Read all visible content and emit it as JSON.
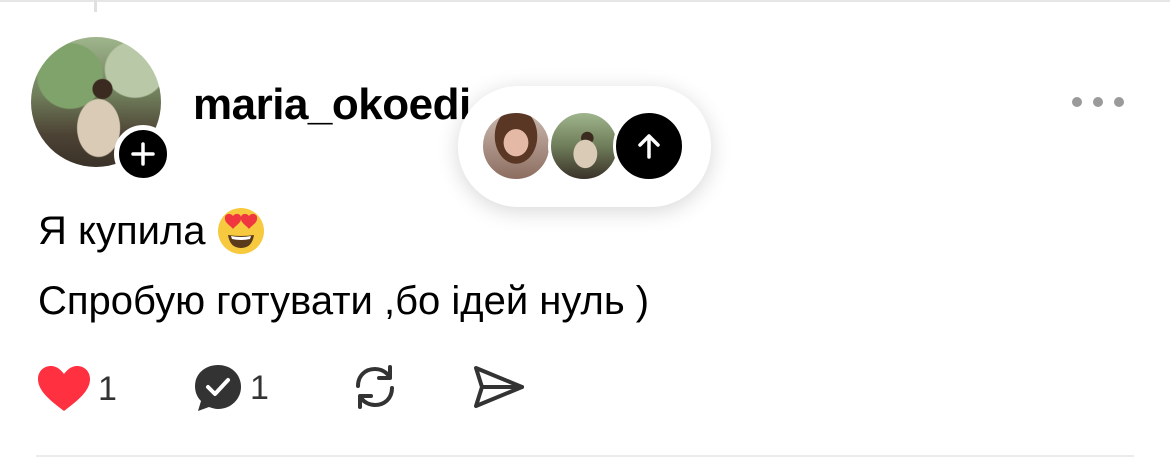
{
  "post": {
    "author": {
      "username": "maria_okoedi"
    },
    "lines": [
      "Я купила",
      "Спробую готувати ,бо ідей нуль )"
    ],
    "emoji": "heart-eyes-emoji"
  },
  "actions": {
    "likes": "1",
    "replies": "1"
  },
  "colors": {
    "heart": "#ff3040",
    "dark": "#000000",
    "muted": "#9a9a9a"
  }
}
